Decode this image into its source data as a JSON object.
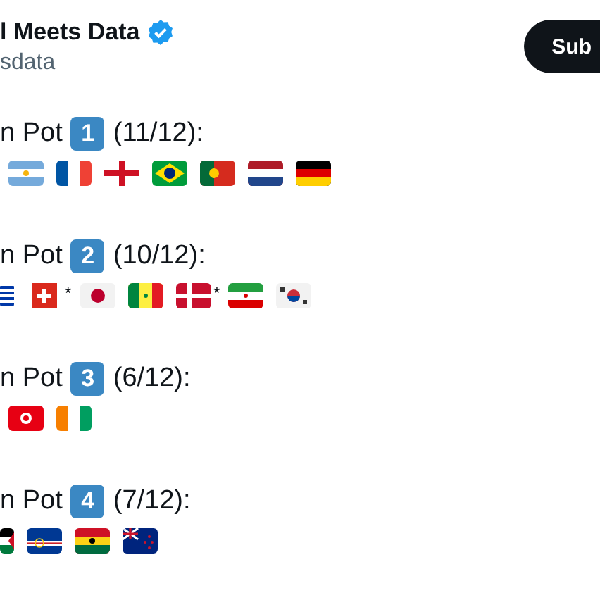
{
  "author": {
    "name": "l Meets Data",
    "verified": true,
    "handle": "sdata"
  },
  "subscribe_button": {
    "label": "Sub"
  },
  "pots": [
    {
      "label": "n Pot",
      "number": "1",
      "count": "(11/12):",
      "flags": [
        {
          "kind": "argentina"
        },
        {
          "kind": "france"
        },
        {
          "kind": "england"
        },
        {
          "kind": "brazil"
        },
        {
          "kind": "portugal"
        },
        {
          "kind": "netherlands"
        },
        {
          "kind": "germany"
        }
      ]
    },
    {
      "label": "n Pot",
      "number": "2",
      "count": "(10/12):",
      "flags": [
        {
          "kind": "uruguay_edge"
        },
        {
          "kind": "switzerland",
          "note": "*"
        },
        {
          "kind": "japan"
        },
        {
          "kind": "senegal"
        },
        {
          "kind": "denmark",
          "note": "*"
        },
        {
          "kind": "iran"
        },
        {
          "kind": "korea"
        }
      ]
    },
    {
      "label": "n Pot",
      "number": "3",
      "count": "(6/12):",
      "flags": [
        {
          "kind": "tunisia"
        },
        {
          "kind": "ivory_coast"
        }
      ]
    },
    {
      "label": "n Pot",
      "number": "4",
      "count": "(7/12):",
      "flags": [
        {
          "kind": "palestine_edge"
        },
        {
          "kind": "cape_verde"
        },
        {
          "kind": "ghana"
        },
        {
          "kind": "new_zealand"
        }
      ]
    }
  ]
}
